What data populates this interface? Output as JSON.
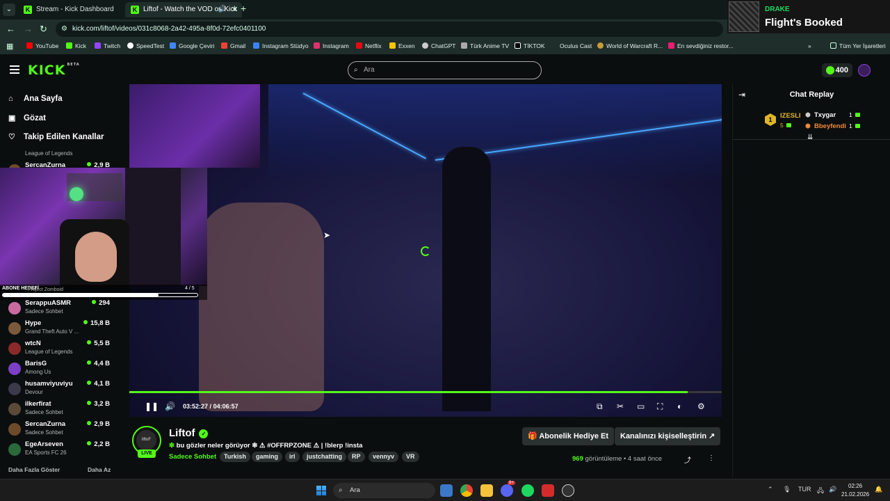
{
  "browser": {
    "tabs": [
      {
        "title": "Stream - Kick Dashboard"
      },
      {
        "title": "Liftof - Watch the VOD on Kick"
      }
    ],
    "url": "kick.com/liftof/videos/031c8068-2a42-495a-8f0d-72efc0401100",
    "bookmarks": [
      "YouTube",
      "Kick",
      "Twitch",
      "SpeedTest",
      "Google Çeviri",
      "Gmail",
      "Instagram Stüdyo",
      "Instagram",
      "Netflix",
      "Exxen",
      "ChatGPT",
      "Türk Anime TV",
      "TİKTOK",
      "Oculus Cast",
      "World of Warcraft R...",
      "En sevdiğiniz restor..."
    ],
    "bookmarks_folder": "Tüm Yer İşaretleri"
  },
  "notification": {
    "artist": "DRAKE",
    "song": "Flight's Booked"
  },
  "header": {
    "logo": "KICK",
    "logo_beta": "BETA",
    "search_placeholder": "Ara",
    "points": "400"
  },
  "sidebar": {
    "nav": [
      {
        "label": "Ana Sayfa"
      },
      {
        "label": "Gözat"
      },
      {
        "label": "Takip Edilen Kanallar"
      }
    ],
    "partial_category": "League of Legends",
    "channels": [
      {
        "name": "SercanZurna",
        "category": "",
        "viewers": "2,9 B",
        "color": "#6d4b2a"
      },
      {
        "name": "SerappuASMR",
        "category": "Sadece Sohbet",
        "viewers": "294",
        "color": "#c96aa0"
      },
      {
        "name": "Hype",
        "category": "Grand Theft Auto V ...",
        "viewers": "15,8 B",
        "color": "#7a5a3a"
      },
      {
        "name": "wtcN",
        "category": "League of Legends",
        "viewers": "5,5 B",
        "color": "#8a2a2a"
      },
      {
        "name": "BarisG",
        "category": "Among Us",
        "viewers": "4,4 B",
        "color": "#7b3fc8"
      },
      {
        "name": "husamviyuviyu",
        "category": "Devour",
        "viewers": "4,1 B",
        "color": "#3a3a4a"
      },
      {
        "name": "ilkerfirat",
        "category": "Sadece Sohbet",
        "viewers": "3,2 B",
        "color": "#5a4a3a"
      },
      {
        "name": "SercanZurna",
        "category": "Sadece Sohbet",
        "viewers": "2,9 B",
        "color": "#6d4b2a"
      },
      {
        "name": "EgeArseven",
        "category": "EA Sports FC 26",
        "viewers": "2,2 B",
        "color": "#2a6a3a"
      }
    ],
    "show_more": "Daha Fazla Göster",
    "show_less": "Daha Az"
  },
  "webcam_overlay": {
    "sub_goal_label": "ABONE HEDEFİ",
    "sub_goal_count": "4 / 5",
    "sub_goal_progress": 0.8,
    "behind_text": "Project Zomboid"
  },
  "player": {
    "current_time": "03:52:27",
    "separator": "/",
    "duration": "04:06:57",
    "progress": 0.943
  },
  "chat": {
    "title": "Chat Replay",
    "top_gifters": [
      {
        "rank": "1",
        "name": "IZESLI",
        "count": "5",
        "color": "#e0b528"
      },
      {
        "rank": "",
        "name": "Txygar",
        "count": "1",
        "color": "#ffffff"
      },
      {
        "rank": "",
        "name": "Bbeyfendi",
        "count": "1",
        "color": "#f08a3a"
      }
    ]
  },
  "channel": {
    "avatar_text": "liftoF",
    "live_badge": "LIVE",
    "name": "Liftof",
    "stream_title": "bu gözler neler görüyor ❇ ⚠ #OFFRPZONE ⚠ | !blerp !insta",
    "category": "Sadece Sohbet",
    "tags": [
      "Turkish",
      "gaming",
      "irl",
      "justchatting",
      "RP",
      "vennyv",
      "VR"
    ],
    "gift_sub_button": "Abonelik Hediye Et",
    "customize_button": "Kanalınızı kişiselleştirin",
    "views": "969",
    "views_label": "görüntüleme",
    "age": "4 saat önce"
  },
  "taskbar": {
    "search_placeholder": "Ara",
    "language": "TUR",
    "time": "02:26",
    "date": "21.02.2026",
    "discord_badge": "9+"
  },
  "colors": {
    "accent": "#53fc18",
    "background": "#0b0e0f",
    "surface": "#2b3130"
  }
}
